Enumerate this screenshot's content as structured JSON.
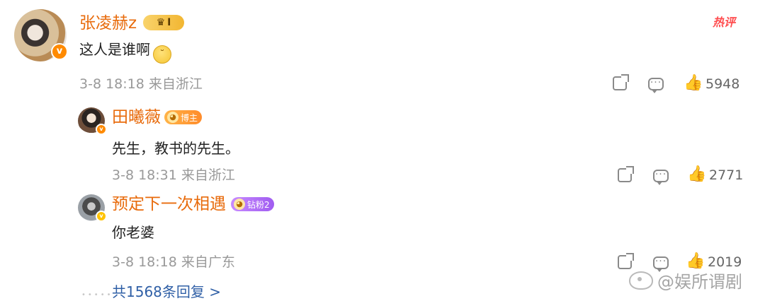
{
  "hot_label": "热评",
  "comments": [
    {
      "user": "张凌赫z",
      "badge": "I",
      "text": "这人是谁啊",
      "emoji": "🙄",
      "date": "3-8 18:18",
      "location": "来自浙江",
      "likes": "5948"
    }
  ],
  "replies": [
    {
      "user": "田曦薇",
      "badge": "博主",
      "text": "先生，教书的先生。",
      "date": "3-8 18:31",
      "location": "来自浙江",
      "likes": "2771"
    },
    {
      "user": "预定下一次相遇",
      "badge": "钻粉2",
      "text": "你老婆",
      "date": "3-8 18:18",
      "location": "来自广东",
      "likes": "2019"
    }
  ],
  "more_replies": "共1568条回复 >",
  "watermark": "@娱所谓剧",
  "icons": {
    "share": "share-icon",
    "comment": "comment-icon",
    "like": "thumbs-up-icon",
    "verified": "verified-badge-icon"
  },
  "colors": {
    "username": "#e86b0c",
    "link": "#2f5fa6",
    "hot_label": "#ff4d4f",
    "meta": "#999999"
  }
}
